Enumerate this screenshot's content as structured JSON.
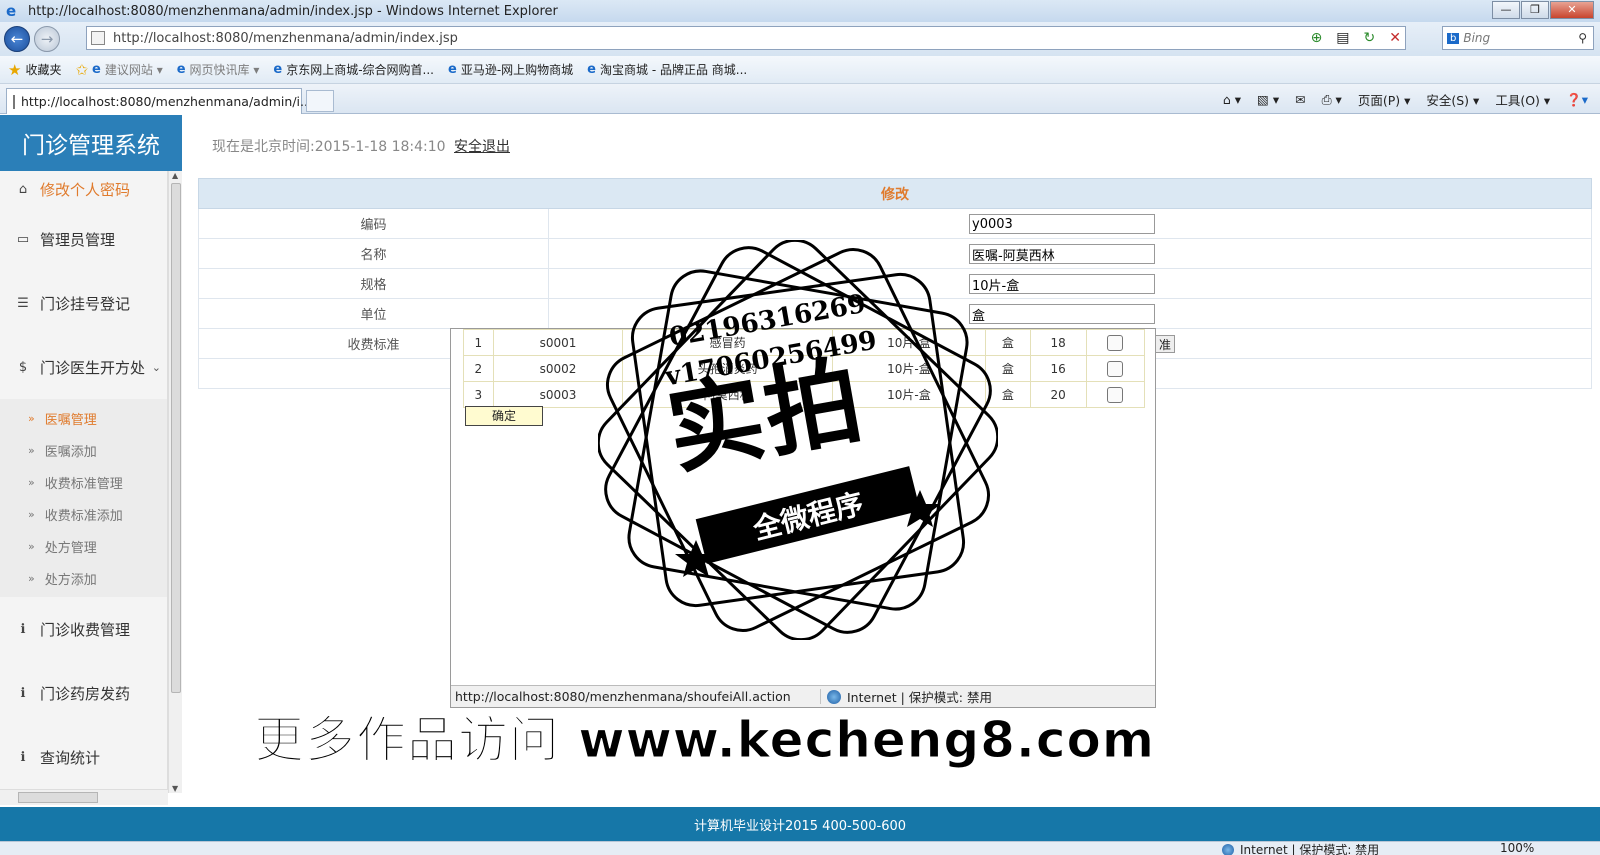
{
  "browser": {
    "title": "http://localhost:8080/menzhenmana/admin/index.jsp - Windows Internet Explorer",
    "url": "http://localhost:8080/menzhenmana/admin/index.jsp",
    "search_placeholder": "Bing",
    "tab_title": "http://localhost:8080/menzhenmana/admin/i...",
    "favorites": [
      "收藏夹",
      "建议网站 ▾",
      "网页快讯库 ▾",
      "京东网上商城-综合网购首...",
      "亚马逊-网上购物商城",
      "淘宝商城 - 品牌正品 商城..."
    ],
    "tools": [
      "页面(P) ▾",
      "安全(S) ▾",
      "工具(O) ▾"
    ],
    "window_buttons": [
      "—",
      "❐",
      "✕"
    ]
  },
  "app": {
    "brand": "门诊管理系统",
    "time": "现在是北京时间:2015-1-18 18:4:10",
    "logout": "安全退出",
    "menu": [
      {
        "label": "修改个人密码",
        "icon": "home-icon"
      },
      {
        "label": "管理员管理",
        "icon": "inbox-icon"
      },
      {
        "label": "门诊挂号登记",
        "icon": "list-icon"
      },
      {
        "label": "门诊医生开方处",
        "icon": "dollar-icon"
      }
    ],
    "submenu": [
      "医嘱管理",
      "医嘱添加",
      "收费标准管理",
      "收费标准添加",
      "处方管理",
      "处方添加"
    ],
    "menu_bottom": [
      {
        "label": "门诊收费管理",
        "icon": "info-icon"
      },
      {
        "label": "门诊药房发药",
        "icon": "info-icon"
      },
      {
        "label": "查询统计",
        "icon": "info-icon"
      }
    ],
    "form": {
      "title": "修改",
      "rows": [
        {
          "label": "编码",
          "value": "y0003"
        },
        {
          "label": "名称",
          "value": "医嘱-阿莫西林"
        },
        {
          "label": "规格",
          "value": "10片-盒"
        },
        {
          "label": "单位",
          "value": "盒"
        },
        {
          "label": "收费标准",
          "value": ""
        }
      ]
    },
    "popup": {
      "rows": [
        {
          "no": "1",
          "code": "s0001",
          "name": "感冒药",
          "spec": "10片-盒",
          "unit": "盒",
          "price": "18"
        },
        {
          "no": "2",
          "code": "s0002",
          "name": "头孢消炎药",
          "spec": "10片-盒",
          "unit": "盒",
          "price": "16"
        },
        {
          "no": "3",
          "code": "s0003",
          "name": "阿莫西林",
          "spec": "10片-盒",
          "unit": "盒",
          "price": "20"
        }
      ],
      "ok": "确定",
      "status_url": "http://localhost:8080/menzhenmana/shoufeiAll.action",
      "status_zone": "Internet | 保护模式: 禁用",
      "cutoff_label": "准"
    },
    "footer": "计算机毕业设计2015  400-500-600"
  },
  "watermark": {
    "phone1": "02196316269",
    "phone2": "v17060256499",
    "big": "实拍",
    "ribbon": "全微程序",
    "site": "更多作品访问 www.kecheng8.com"
  },
  "ie_status": {
    "zone": "Internet | 保护模式: 禁用",
    "zoom": "100%"
  }
}
